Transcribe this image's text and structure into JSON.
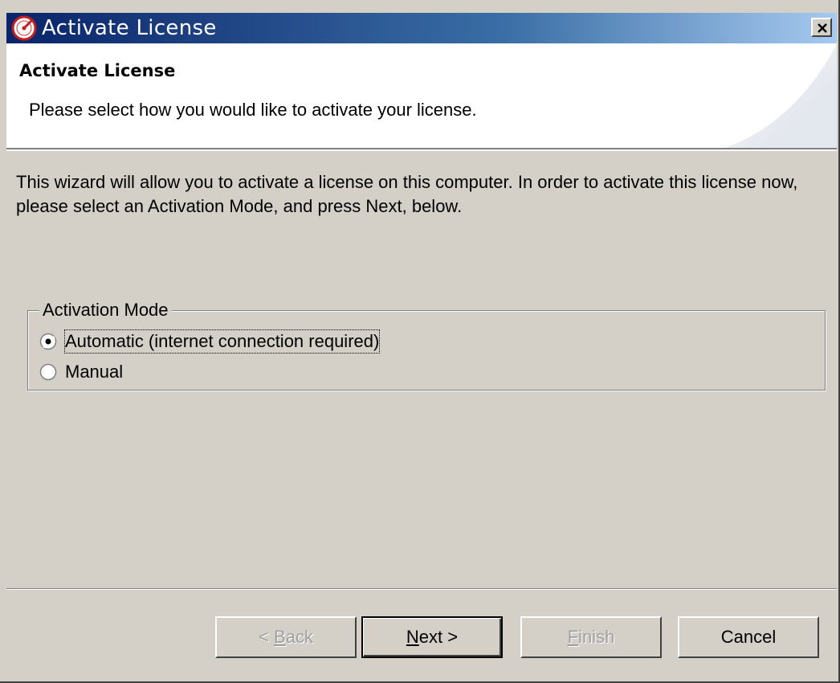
{
  "window": {
    "title": "Activate License",
    "close_label": "×"
  },
  "banner": {
    "title": "Activate License",
    "description": "Please select how you would like to activate your license."
  },
  "intro": {
    "text": "This wizard will allow you to activate a license on this computer. In order to activate this license now, please select an Activation Mode, and press Next, below."
  },
  "activation_mode": {
    "legend": "Activation Mode",
    "options": [
      {
        "label": "Automatic (internet connection required)",
        "selected": true
      },
      {
        "label": "Manual",
        "selected": false
      }
    ]
  },
  "buttons": {
    "back": {
      "pre": "< ",
      "accel": "B",
      "rest": "ack",
      "enabled": false
    },
    "next": {
      "accel": "N",
      "rest": "ext >",
      "enabled": true
    },
    "finish": {
      "accel": "F",
      "rest": "inish",
      "enabled": false
    },
    "cancel": {
      "label": "Cancel",
      "enabled": true
    }
  },
  "colors": {
    "face": "#d4d0c8",
    "titlebar_start": "#0a246a",
    "titlebar_end": "#a6caf0",
    "disabled_text": "#a0a0a0"
  }
}
